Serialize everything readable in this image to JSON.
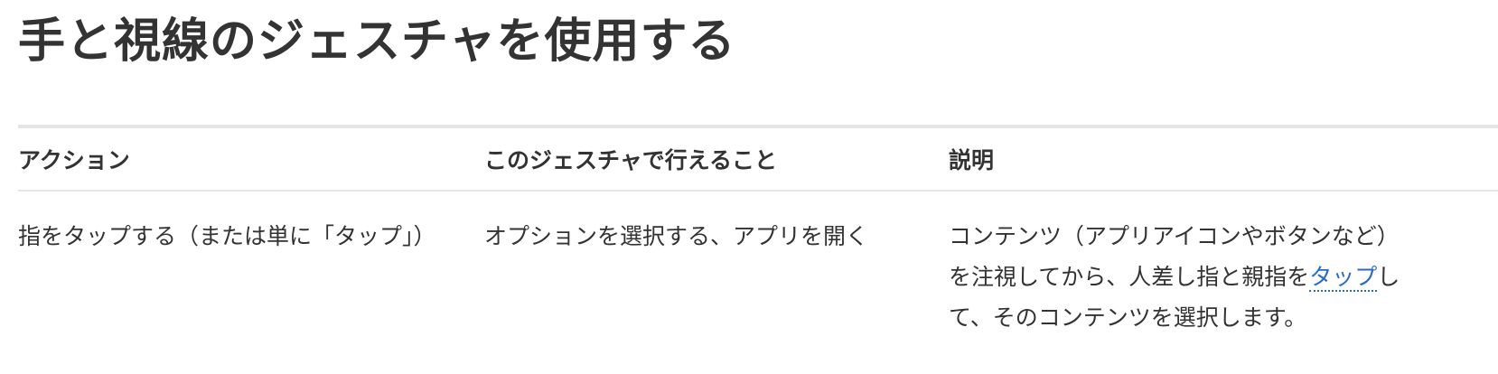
{
  "page": {
    "title": "手と視線のジェスチャを使用する"
  },
  "table": {
    "headers": {
      "action": "アクション",
      "what": "このジェスチャで行えること",
      "description": "説明"
    },
    "rows": [
      {
        "action": "指をタップする（または単に「タップ」）",
        "what": "オプションを選択する、アプリを開く",
        "description_before": "コンテンツ（アプリアイコンやボタンなど）を注視してから、人差し指と親指を",
        "description_link": "タップ",
        "description_after": "して、そのコンテンツを選択します。"
      }
    ]
  },
  "colors": {
    "text": "#333333",
    "link": "#2a6bc4",
    "rule": "#e5e5e5"
  }
}
